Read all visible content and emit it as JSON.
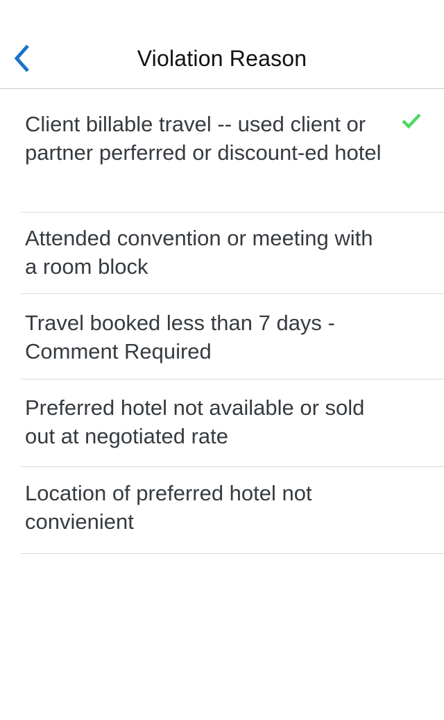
{
  "header": {
    "title": "Violation Reason",
    "back_icon": "chevron-left-icon"
  },
  "colors": {
    "accent": "#1a73c7",
    "check": "#4cd964",
    "separator": "#d9d9d9"
  },
  "reasons": [
    {
      "label": "Client billable travel -- used client or partner perferred or discount-ed hotel",
      "selected": true
    },
    {
      "label": "Attended convention or meeting with a room block",
      "selected": false
    },
    {
      "label": "Travel booked less than 7 days - Comment Required",
      "selected": false
    },
    {
      "label": "Preferred hotel not available or sold out at negotiated rate",
      "selected": false
    },
    {
      "label": "Location of preferred hotel not convienient",
      "selected": false
    }
  ]
}
